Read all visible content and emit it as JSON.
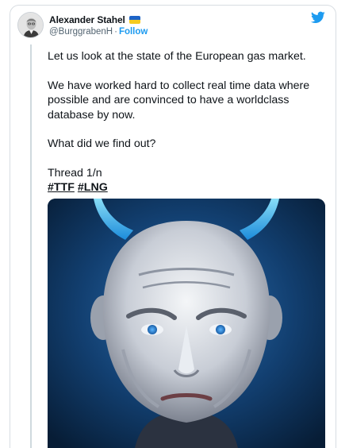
{
  "author": {
    "display_name": "Alexander Stahel",
    "handle": "@BurggrabenH",
    "separator": "·",
    "follow_label": "Follow",
    "flag": "ukraine-flag",
    "avatar": "portrait-avatar"
  },
  "platform_icon": "twitter-bird-icon",
  "tweet": {
    "line1": "Let us look at the state of the European gas market.",
    "line2": "We have worked hard to collect real time data where possible and are convinced to have a worldclass database by now.",
    "line3": "What did we find out?",
    "line4": "Thread 1/n",
    "hashtags": [
      "#TTF",
      "#LNG"
    ]
  },
  "media": {
    "kind": "illustration"
  },
  "colors": {
    "accent": "#1d9bf0",
    "text": "#0f1419",
    "secondary": "#536471",
    "flag_blue": "#1d64c7",
    "flag_yellow": "#f6cb20"
  }
}
